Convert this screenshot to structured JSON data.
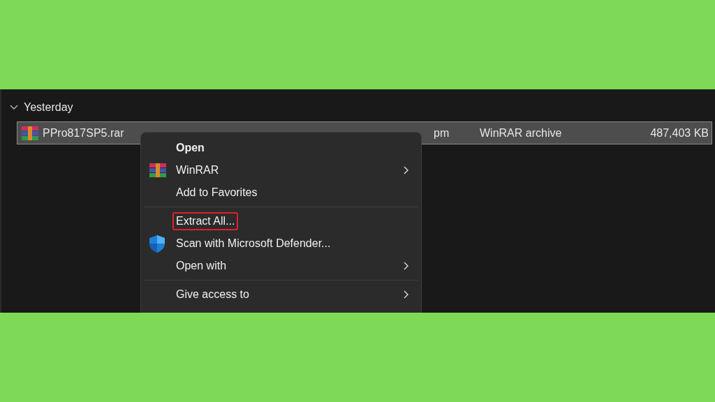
{
  "group": {
    "label": "Yesterday",
    "expanded": true
  },
  "file": {
    "name": "PPro817SP5.rar",
    "date": "pm",
    "type": "WinRAR archive",
    "size": "487,403 KB",
    "selected": true
  },
  "context_menu": {
    "groups": [
      [
        {
          "label": "Open",
          "kind": "plain",
          "bold": true,
          "submenu": false,
          "outlined": false
        },
        {
          "label": "WinRAR",
          "kind": "archive",
          "bold": false,
          "submenu": true,
          "outlined": false
        },
        {
          "label": "Add to Favorites",
          "kind": "plain",
          "bold": false,
          "submenu": false,
          "outlined": false
        }
      ],
      [
        {
          "label": "Extract All...",
          "kind": "plain",
          "bold": false,
          "submenu": false,
          "outlined": true
        },
        {
          "label": "Scan with Microsoft Defender...",
          "kind": "shield",
          "bold": false,
          "submenu": false,
          "outlined": false
        },
        {
          "label": "Open with",
          "kind": "plain",
          "bold": false,
          "submenu": true,
          "outlined": false
        }
      ],
      [
        {
          "label": "Give access to",
          "kind": "plain",
          "bold": false,
          "submenu": true,
          "outlined": false
        }
      ]
    ]
  }
}
